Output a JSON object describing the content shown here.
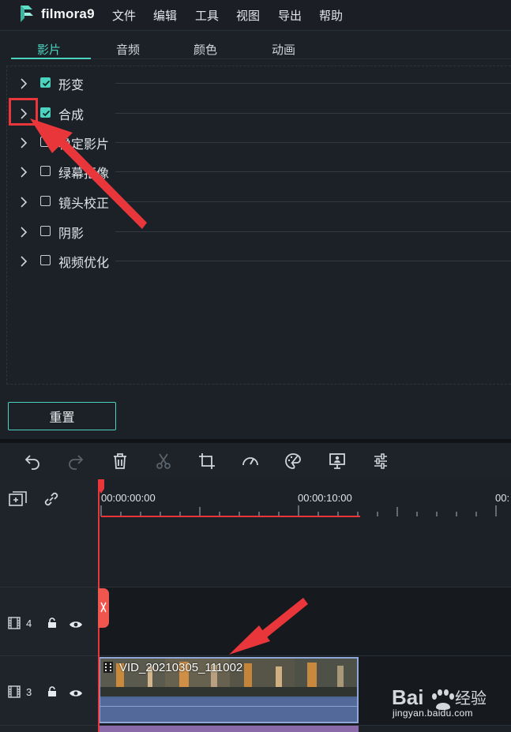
{
  "app": {
    "brand": "filmora9"
  },
  "menu": {
    "items": [
      "文件",
      "编辑",
      "工具",
      "视图",
      "导出",
      "帮助"
    ]
  },
  "tabs": [
    {
      "label": "影片",
      "active": true
    },
    {
      "label": "音频",
      "active": false
    },
    {
      "label": "颜色",
      "active": false
    },
    {
      "label": "动画",
      "active": false
    }
  ],
  "properties": [
    {
      "label": "形变",
      "checked": true
    },
    {
      "label": "合成",
      "checked": true
    },
    {
      "label": "稳定影片",
      "checked": false
    },
    {
      "label": "绿幕抠像",
      "checked": false
    },
    {
      "label": "镜头校正",
      "checked": false
    },
    {
      "label": "阴影",
      "checked": false
    },
    {
      "label": "视频优化",
      "checked": false
    }
  ],
  "reset_label": "重置",
  "toolbar": {
    "icons": [
      "undo-icon",
      "redo-icon",
      "delete-icon",
      "cut-icon",
      "crop-icon",
      "speed-icon",
      "color-icon",
      "green-screen-icon",
      "audio-mixer-icon"
    ]
  },
  "timeline": {
    "timecodes": [
      "00:00:00:00",
      "00:00:10:00",
      "00:"
    ],
    "tracks": [
      {
        "number": "4"
      },
      {
        "number": "3"
      }
    ],
    "clip": {
      "title": "VID_20210305_111002"
    }
  },
  "watermark": {
    "text": "Bai 经验",
    "sub": "jingyan.baidu.com"
  },
  "colors": {
    "accent": "#4bd3bf",
    "highlight": "#e8363a",
    "clip": "#4d6594"
  }
}
